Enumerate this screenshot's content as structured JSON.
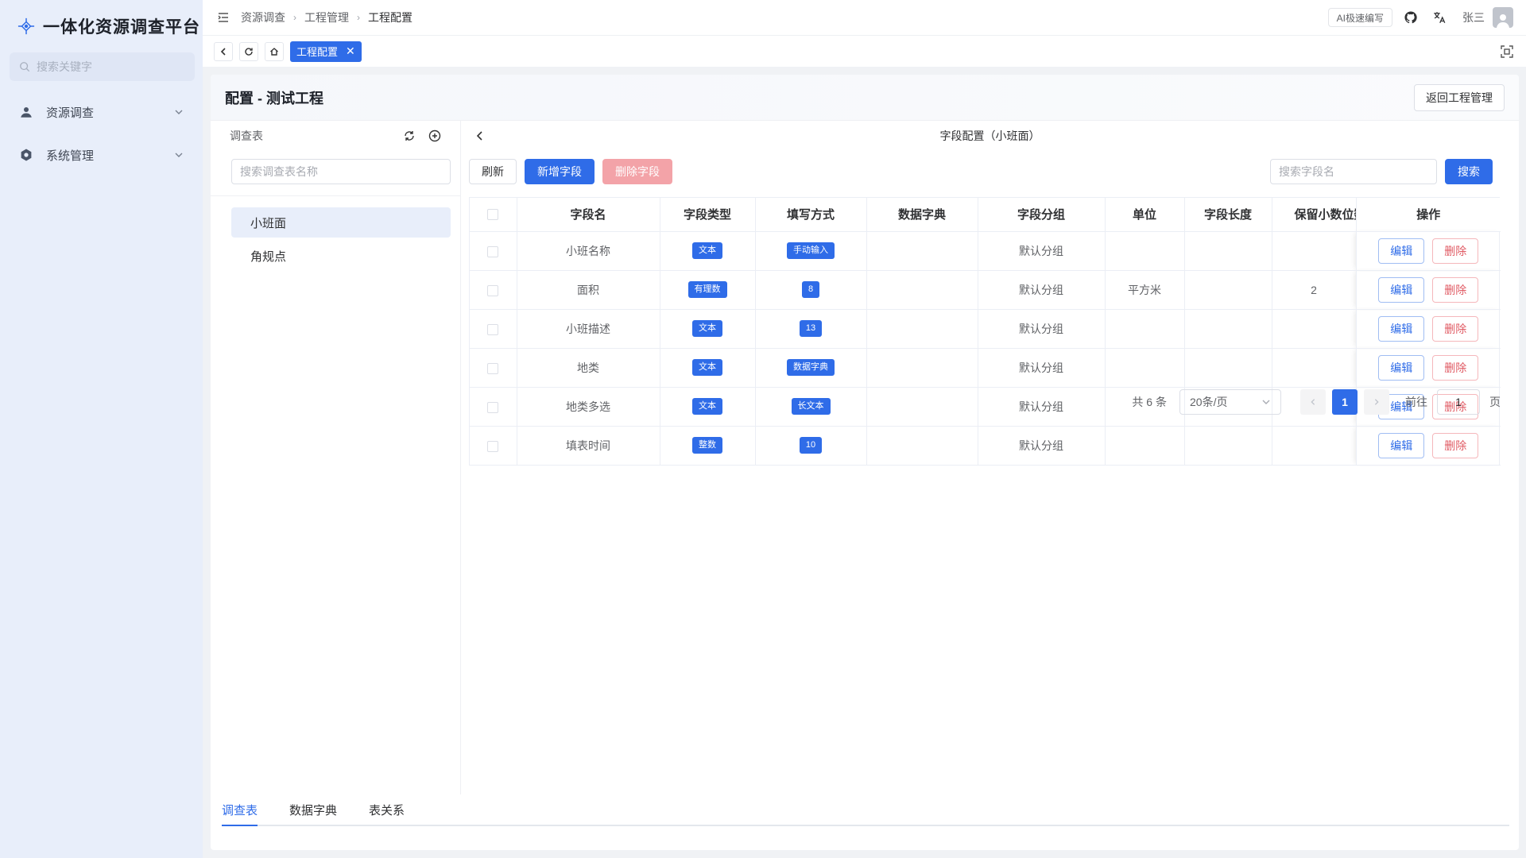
{
  "app": {
    "title": "一体化资源调查平台"
  },
  "sidebar": {
    "search_placeholder": "搜索关键字",
    "items": [
      {
        "label": "资源调查",
        "icon": "user-pin-icon"
      },
      {
        "label": "系统管理",
        "icon": "gear-icon"
      }
    ]
  },
  "topbar": {
    "breadcrumb": [
      "资源调查",
      "工程管理",
      "工程配置"
    ],
    "ai_button": "AI极速编写",
    "user_name": "张三"
  },
  "tabs": {
    "active_tab": "工程配置"
  },
  "page": {
    "title": "配置 - 测试工程",
    "back_button": "返回工程管理"
  },
  "left_panel": {
    "title": "调查表",
    "search_placeholder": "搜索调查表名称",
    "items": [
      "小班面",
      "角规点"
    ]
  },
  "right_panel": {
    "title": "字段配置（小班面）",
    "refresh": "刷新",
    "add_field": "新增字段",
    "delete_field": "删除字段",
    "search_placeholder": "搜索字段名",
    "search_button": "搜索"
  },
  "table": {
    "headers": [
      "字段名",
      "字段类型",
      "填写方式",
      "数据字典",
      "字段分组",
      "单位",
      "字段长度",
      "保留小数位数",
      "操作"
    ],
    "edit_label": "编辑",
    "delete_label": "删除",
    "rows": [
      {
        "name": "小班名称",
        "type": "文本",
        "fill": "手动输入",
        "dict": "",
        "group": "默认分组",
        "unit": "",
        "length": "",
        "decimals": ""
      },
      {
        "name": "面积",
        "type": "有理数",
        "fill": "8",
        "dict": "",
        "group": "默认分组",
        "unit": "平方米",
        "length": "",
        "decimals": "2"
      },
      {
        "name": "小班描述",
        "type": "文本",
        "fill": "13",
        "dict": "",
        "group": "默认分组",
        "unit": "",
        "length": "",
        "decimals": ""
      },
      {
        "name": "地类",
        "type": "文本",
        "fill": "数据字典",
        "dict": "",
        "group": "默认分组",
        "unit": "",
        "length": "",
        "decimals": ""
      },
      {
        "name": "地类多选",
        "type": "文本",
        "fill": "长文本",
        "dict": "",
        "group": "默认分组",
        "unit": "",
        "length": "",
        "decimals": ""
      },
      {
        "name": "填表时间",
        "type": "整数",
        "fill": "10",
        "dict": "",
        "group": "默认分组",
        "unit": "",
        "length": "",
        "decimals": ""
      }
    ]
  },
  "pagination": {
    "total": "共 6 条",
    "page_size": "20条/页",
    "current": "1",
    "goto_label": "前往",
    "goto_value": "1",
    "page_suffix": "页"
  },
  "bottom_tabs": [
    "调查表",
    "数据字典",
    "表关系"
  ],
  "colors": {
    "primary": "#2f6ce8",
    "danger": "#e05a63",
    "sidebar_bg": "#e8eefa"
  }
}
